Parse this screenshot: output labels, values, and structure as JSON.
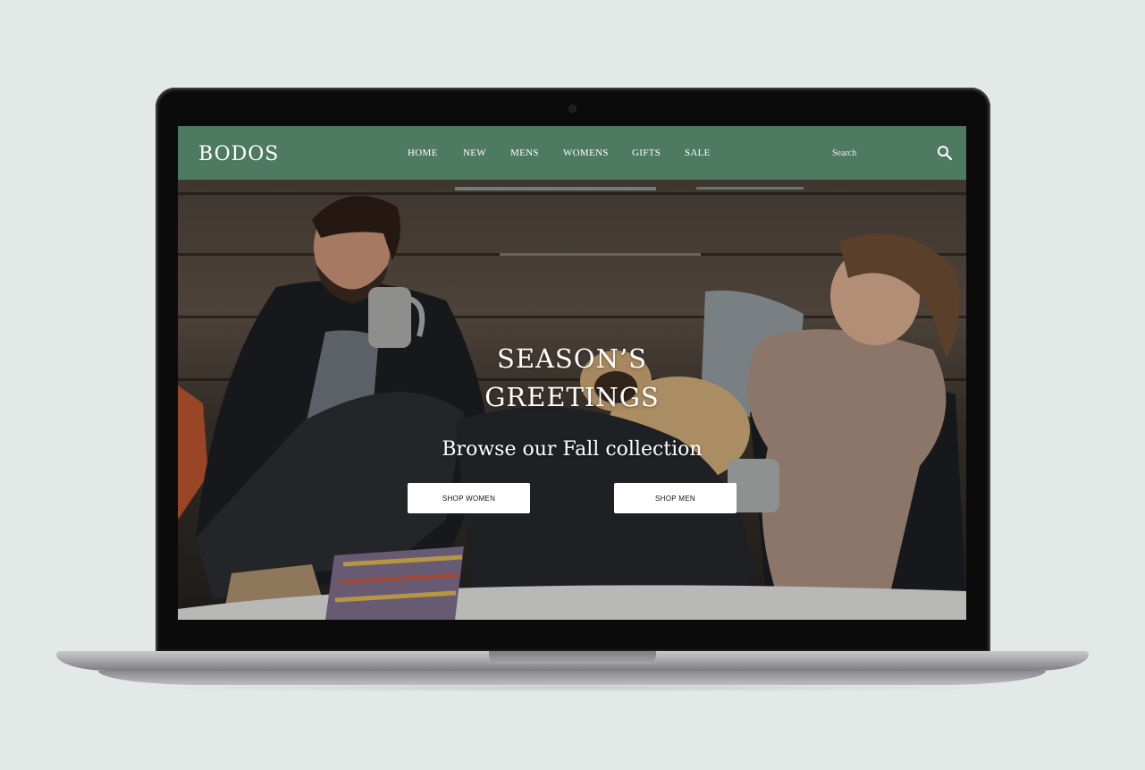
{
  "header": {
    "logo": "BODOS",
    "nav": [
      "HOME",
      "NEW",
      "MENS",
      "WOMENS",
      "GIFTS",
      "SALE"
    ],
    "search": {
      "placeholder": "Search",
      "icon": "search-icon"
    }
  },
  "hero": {
    "title": "SEASON’S\nGREETINGS",
    "subtitle": "Browse our Fall collection",
    "buttons": {
      "women": "SHOP WOMEN",
      "men": "SHOP MEN"
    }
  },
  "colors": {
    "nav_bg": "#4f7a62",
    "page_bg": "#e3e9e7",
    "button_bg": "#ffffff"
  }
}
